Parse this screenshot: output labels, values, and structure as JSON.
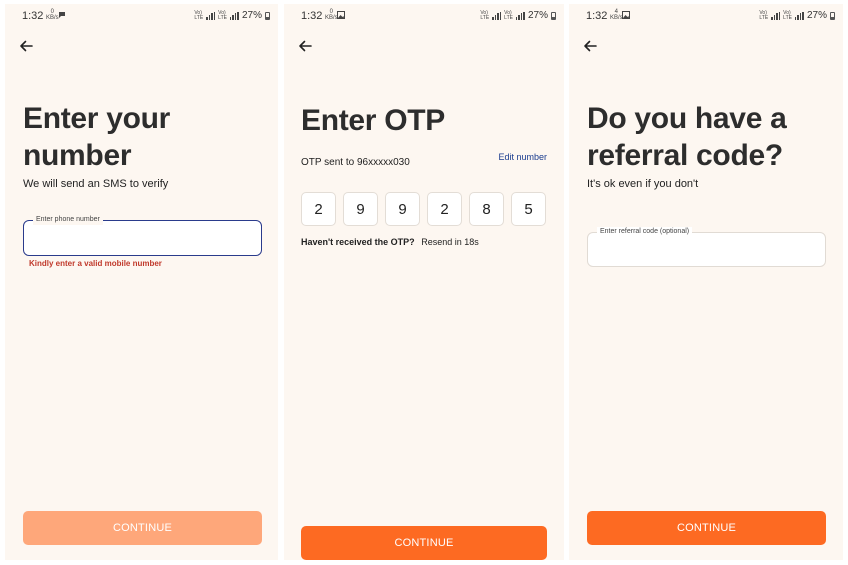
{
  "status": {
    "time": "1:32",
    "battery": "27%",
    "net_label": "VoLTE",
    "speed1": "0 KB/s",
    "speed3": "4 KB/s"
  },
  "screen1": {
    "title_line1": "Enter your",
    "title_line2": "number",
    "subtitle": "We will send an SMS to verify",
    "phone_label": "Enter phone number",
    "phone_value": "",
    "error": "Kindly enter a valid mobile number",
    "continue_label": "CONTINUE",
    "continue_color": "#fea77a"
  },
  "screen2": {
    "title": "Enter OTP",
    "sent_to": "OTP sent to 96xxxxx030",
    "edit_label": "Edit number",
    "otp_digits": [
      "2",
      "9",
      "9",
      "2",
      "8",
      "5"
    ],
    "not_received": "Haven't received the OTP?",
    "resend": "Resend in 18s",
    "continue_label": "CONTINUE",
    "continue_color": "#fd6a22"
  },
  "screen3": {
    "title_line1": "Do you have a",
    "title_line2": "referral code?",
    "subtitle": "It's ok even if you don't",
    "referral_label": "Enter referral code (optional)",
    "referral_value": "",
    "continue_label": "CONTINUE",
    "continue_color": "#fd6a22"
  },
  "colors": {
    "background": "#fdf7f1",
    "accent": "#fd6a22",
    "link": "#1a3c8f",
    "error": "#c0392b",
    "focus_border": "#2a3b8c"
  },
  "icons": {
    "back": "back-arrow-icon",
    "message": "message-icon",
    "image": "image-icon",
    "signal": "signal-icon",
    "battery": "battery-icon"
  }
}
